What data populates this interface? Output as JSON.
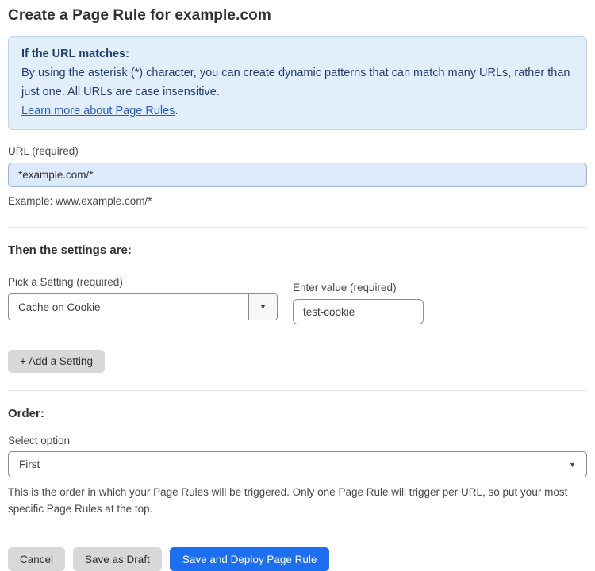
{
  "page": {
    "title": "Create a Page Rule for example.com"
  },
  "info_box": {
    "heading": "If the URL matches:",
    "body": "By using the asterisk (*) character, you can create dynamic patterns that can match many URLs, rather than just one. All URLs are case insensitive.",
    "link_label": "Learn more about Page Rules",
    "link_suffix": "."
  },
  "url_section": {
    "label": "URL (required)",
    "value": "*example.com/*",
    "helper": "Example: www.example.com/*"
  },
  "settings_section": {
    "heading": "Then the settings are:",
    "setting_label": "Pick a Setting (required)",
    "setting_value": "Cache on Cookie",
    "value_label": "Enter value (required)",
    "value_input": "test-cookie",
    "add_button_label": "+ Add a Setting"
  },
  "order_section": {
    "heading": "Order:",
    "label": "Select option",
    "selected_option": "First",
    "helper": "This is the order in which your Page Rules will be triggered. Only one Page Rule will trigger per URL, so put your most specific Page Rules at the top."
  },
  "footer": {
    "cancel_label": "Cancel",
    "save_draft_label": "Save as Draft",
    "save_deploy_label": "Save and Deploy Page Rule"
  },
  "icons": {
    "dropdown_arrow": "▼"
  },
  "colors": {
    "info_bg": "#e3eefb",
    "info_border": "#bcd4ef",
    "info_text": "#1f3d70",
    "link_blue": "#2c5cc7",
    "url_input_bg": "#dceafb",
    "primary_button": "#1d6ff2",
    "gray_button": "#d8d8d8"
  }
}
